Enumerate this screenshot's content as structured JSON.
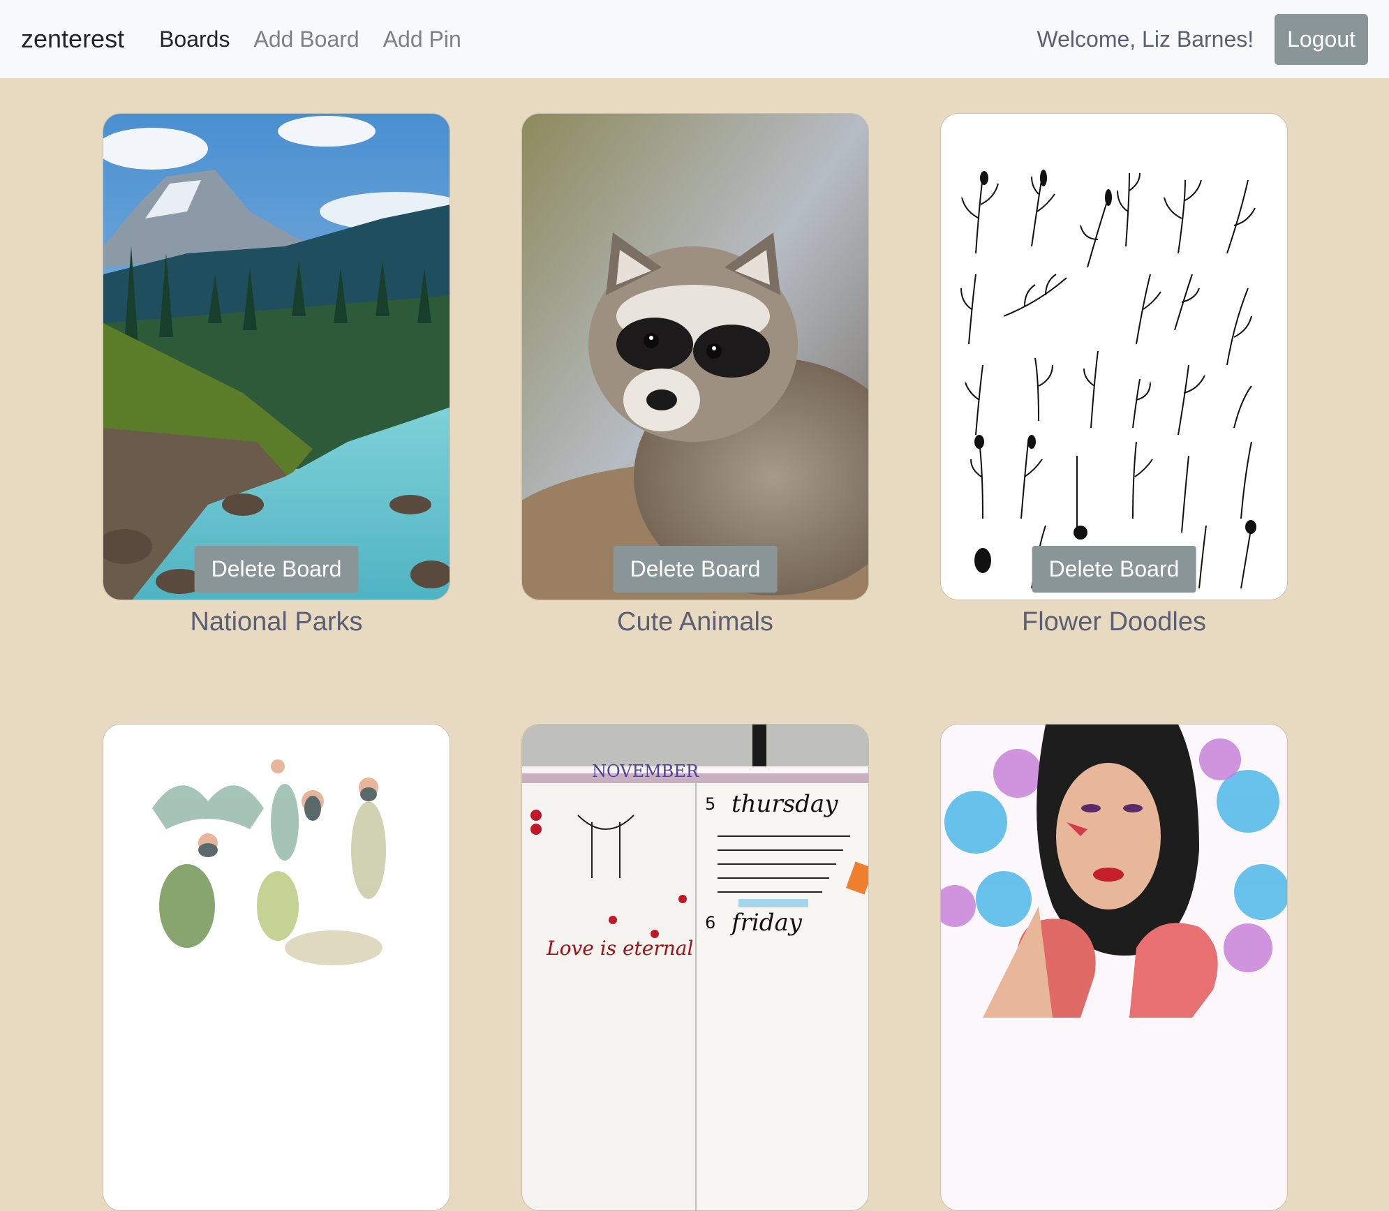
{
  "nav": {
    "brand": "zenterest",
    "links": [
      "Boards",
      "Add Board",
      "Add Pin"
    ],
    "welcome": "Welcome, Liz Barnes!",
    "logout": "Logout"
  },
  "boards": [
    {
      "title": "National Parks",
      "delete_label": "Delete Board",
      "image": "mountain-river-photo"
    },
    {
      "title": "Cute Animals",
      "delete_label": "Delete Board",
      "image": "raccoon-photo"
    },
    {
      "title": "Flower Doodles",
      "delete_label": "Delete Board",
      "image": "flower-doodles-illustration"
    },
    {
      "title": "",
      "delete_label": "",
      "image": "yoga-poses-illustration"
    },
    {
      "title": "",
      "delete_label": "",
      "image": "bullet-journal-photo"
    },
    {
      "title": "",
      "delete_label": "",
      "image": "boxer-woman-illustration"
    }
  ],
  "journal_text": {
    "month": "NOVEMBER",
    "day_thursday": "thursday",
    "day_friday": "friday",
    "num5": "5",
    "num6": "6",
    "tag": "Love is eternal"
  },
  "colors": {
    "background": "#e8dac1",
    "navbar": "#f8f9fa",
    "button": "#8a9598",
    "title_text": "#5a5f73"
  }
}
